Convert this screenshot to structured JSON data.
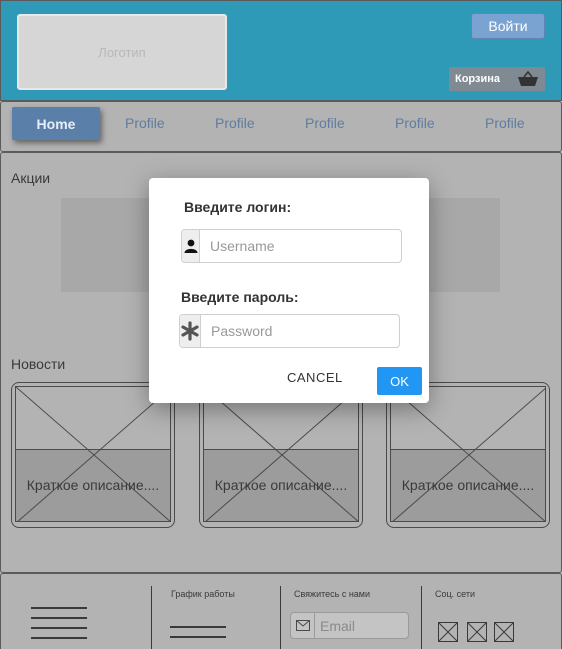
{
  "header": {
    "logo_text": "Логотип",
    "login_label": "Войти",
    "cart_label": "Корзина",
    "cart_icon": "basket-icon"
  },
  "nav": {
    "home_label": "Home",
    "items": [
      "Profile",
      "Profile",
      "Profile",
      "Profile",
      "Profile"
    ]
  },
  "main": {
    "promos_label": "Акции",
    "news_label": "Новости",
    "news_cards": [
      {
        "caption": "Краткое описание...."
      },
      {
        "caption": "Краткое описание...."
      },
      {
        "caption": "Краткое описание...."
      }
    ]
  },
  "footer": {
    "schedule_label": "График работы",
    "contact_label": "Свяжитесь с нами",
    "email_placeholder": "Email",
    "social_label": "Соц. сети"
  },
  "modal": {
    "login_label": "Введите логин:",
    "username_placeholder": "Username",
    "password_label": "Введите пароль:",
    "password_placeholder": "Password",
    "cancel_label": "CANCEL",
    "ok_label": "OK",
    "accent_color": "#2196f3"
  }
}
